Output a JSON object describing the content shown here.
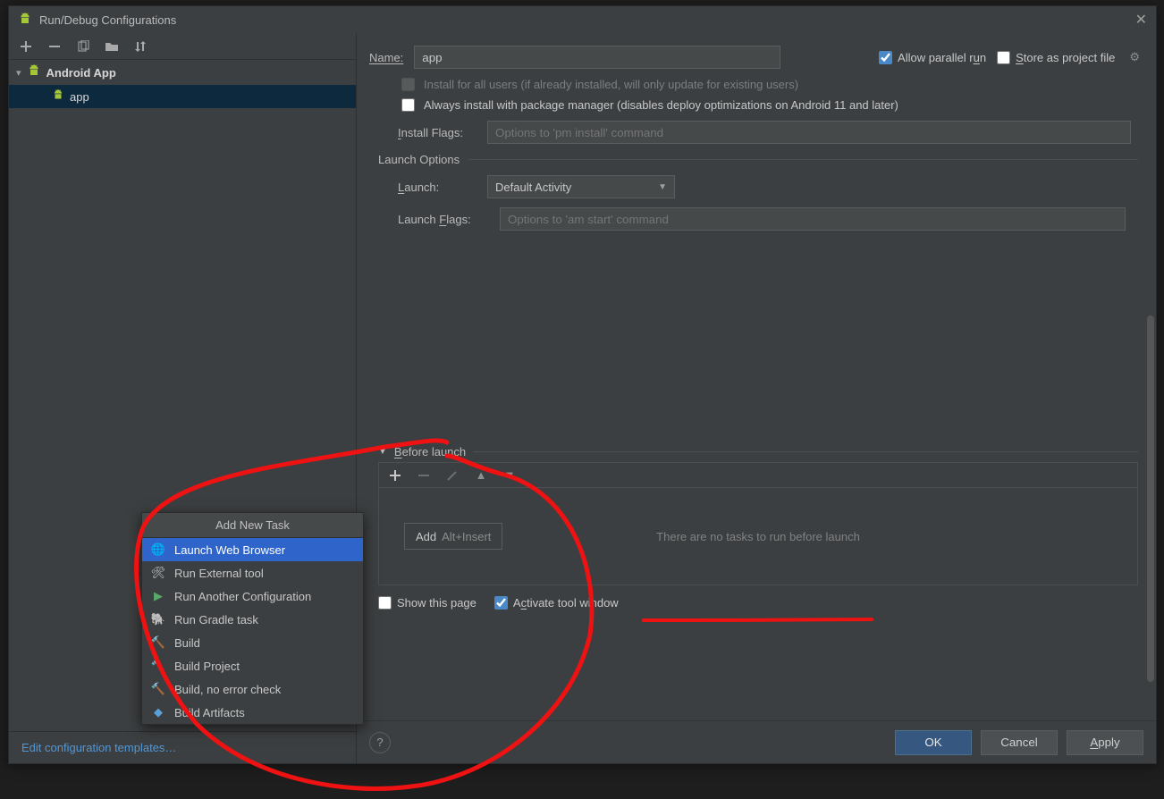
{
  "dialog": {
    "title": "Run/Debug Configurations"
  },
  "side": {
    "group": "Android App",
    "item": "app",
    "editTemplates": "Edit configuration templates…"
  },
  "header": {
    "nameLabel": "Name:",
    "nameValue": "app",
    "allowParallel": "Allow parallel run",
    "storeProject": "Store as project file"
  },
  "form": {
    "installAll": "Install for all users (if already installed, will only update for existing users)",
    "alwaysPm": "Always install with package manager (disables deploy optimizations on Android 11 and later)",
    "installFlagsLabel": "Install Flags:",
    "installFlagsPh": "Options to 'pm install' command",
    "launchOptions": "Launch Options",
    "launchLabel": "Launch:",
    "launchValue": "Default Activity",
    "launchFlagsLabel": "Launch Flags:",
    "launchFlagsPh": "Options to 'am start' command"
  },
  "before": {
    "title": "Before launch",
    "addBtn": "Add",
    "addShortcut": "Alt+Insert",
    "noTasks": "There are no tasks to run before launch",
    "showPage": "Show this page",
    "activateTool": "Activate tool window"
  },
  "footer": {
    "ok": "OK",
    "cancel": "Cancel",
    "apply": "Apply"
  },
  "popup": {
    "title": "Add New Task",
    "items": [
      "Launch Web Browser",
      "Run External tool",
      "Run Another Configuration",
      "Run Gradle task",
      "Build",
      "Build Project",
      "Build, no error check",
      "Build Artifacts"
    ]
  }
}
